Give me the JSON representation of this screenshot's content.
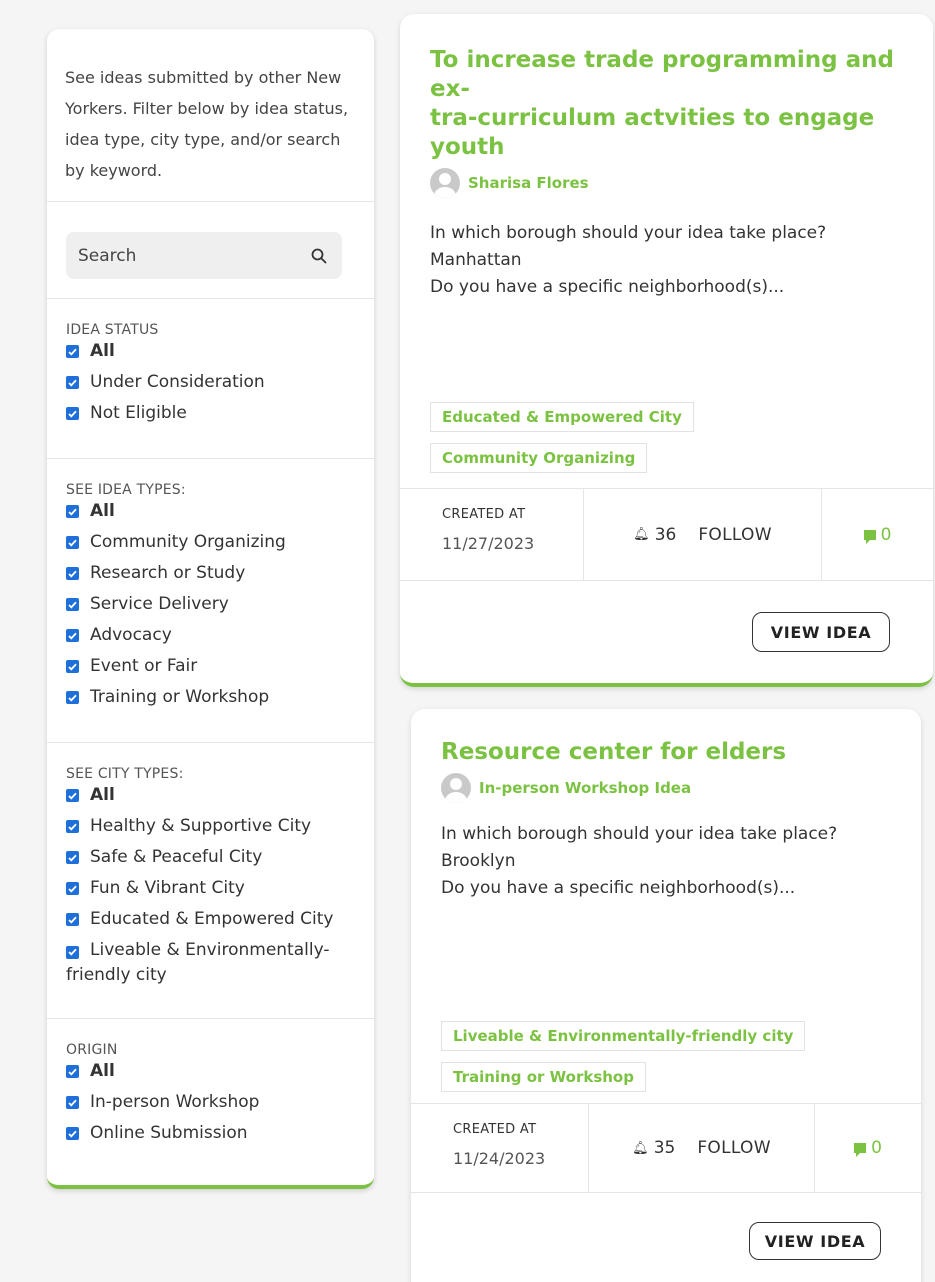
{
  "sidebar": {
    "intro": "See ideas submitted by other New Yorkers. Filter below by idea status, idea type, city type, and/or search by keyword.",
    "search": {
      "placeholder": "Search"
    },
    "idea_status": {
      "title": "IDEA STATUS",
      "items": [
        "All",
        "Under Consideration",
        "Not Eligible"
      ]
    },
    "idea_types": {
      "title": "SEE IDEA TYPES:",
      "items": [
        "All",
        "Community Organizing",
        "Research or Study",
        "Service Delivery",
        "Advocacy",
        "Event or Fair",
        "Training or Workshop"
      ]
    },
    "city_types": {
      "title": "SEE CITY TYPES:",
      "items": [
        "All",
        "Healthy & Supportive City",
        "Safe & Peaceful City",
        "Fun & Vibrant City",
        "Educated & Empowered City",
        "Liveable & Environmentally-friendly city"
      ]
    },
    "origin": {
      "title": "ORIGIN",
      "items": [
        "All",
        "In-person Workshop",
        "Online Submission"
      ]
    }
  },
  "cards": [
    {
      "title": "To increase trade programming and extra-curriculum actvities to engage youth",
      "title_display": "To increase trade programming and ex-\ntra-curriculum actvities to engage\nyouth",
      "author": "Sharisa Flores",
      "excerpt_q": "In which borough should your idea take place?",
      "excerpt_a": "Manhattan",
      "excerpt_more": "Do you have a specific neighborhood(s)...",
      "tags": [
        "Educated & Empowered City",
        "Community Organizing"
      ],
      "created_label": "CREATED AT",
      "created_date": "11/27/2023",
      "follow_count": "36",
      "follow_label": "FOLLOW",
      "comments": "0",
      "view_label": "VIEW IDEA"
    },
    {
      "title": "Resource center for elders",
      "author": "In-person Workshop Idea",
      "excerpt_q": "In which borough should your idea take place?",
      "excerpt_a": "Brooklyn",
      "excerpt_more": "Do you have a specific neighborhood(s)...",
      "tags": [
        "Liveable & Environmentally-friendly city",
        "Training or Workshop"
      ],
      "created_label": "CREATED AT",
      "created_date": "11/24/2023",
      "follow_count": "35",
      "follow_label": "FOLLOW",
      "comments": "0",
      "view_label": "VIEW IDEA"
    }
  ],
  "colors": {
    "accent": "#7cc242",
    "checkbox": "#1e6fd9"
  },
  "icons": {
    "search": "search-icon",
    "bell": "bell-icon",
    "comment": "comment-icon",
    "avatar": "user-avatar-icon",
    "check": "check-icon"
  }
}
